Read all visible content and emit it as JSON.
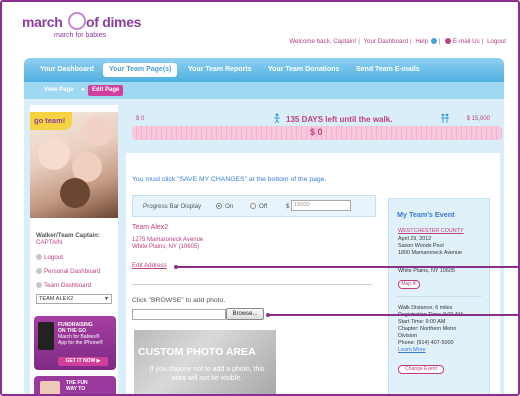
{
  "header": {
    "logo_word1": "march",
    "logo_word2": "of dimes",
    "logo_tagline": "march for babies",
    "links": [
      "Welcome back, Captain!",
      "Your Dashboard",
      "Help",
      "E-mail Us",
      "Logout"
    ]
  },
  "tabs": [
    {
      "label": "Your Dashboard"
    },
    {
      "label": "Your Team Page(s)"
    },
    {
      "label": "Your Team Reports"
    },
    {
      "label": "Your Team Donations"
    },
    {
      "label": "Send Team E-mails"
    }
  ],
  "subtabs": [
    {
      "label": "View Page"
    },
    {
      "label": "Edit Page"
    }
  ],
  "sidebar": {
    "photo_badge": "go team!",
    "walker_label": "Walker/Team Captain:",
    "walker_value": "CAPTAIN",
    "links": [
      "Logout",
      "Personal Dashboard",
      "Team Dashboard"
    ],
    "team_select": "TEAM ALEX2",
    "promo1_text": [
      "FUNDRAISING",
      "ON THE GO",
      "March for Babies®",
      "App for the iPhone®"
    ],
    "promo1_button": "GET IT NOW ▶",
    "promo2_text": [
      "THE FUN",
      "WAY TO"
    ]
  },
  "progress": {
    "start_amount": "$ 0",
    "goal_amount": "$ 15,000",
    "days_left": "135 DAYS left until the walk.",
    "current": "$ 0",
    "fraction": 0
  },
  "form": {
    "notice": "You must click \"SAVE MY CHANGES\" at the bottom of the page.",
    "progress_bar_label": "Progress Bar Display",
    "on_label": "On",
    "off_label": "Off",
    "dollar_sign": "$",
    "goal_value": "15000",
    "team_name": "Team Alex2",
    "address_line1": "1275 Mamaroneck Avenue",
    "address_line2": "White Plains, NY (10605)",
    "edit_address": "Edit Address",
    "browse_hint": "Click \"BROWSE\" to add photo.",
    "browse_label": "Browse...",
    "photo_area_title": "CUSTOM PHOTO AREA",
    "photo_area_sub": "If you choose not to add a photo, this area will not be visible."
  },
  "event": {
    "title": "My Team's Event",
    "county": "WESTCHESTER COUNTY",
    "lines": [
      "April 29, 2012",
      "Saxon Woods Pool",
      "1800 Mamaroneck Avenue"
    ],
    "city": "White Plains, NY 10605",
    "map_label": "Map It!",
    "details": [
      "Walk Distance: 6 miles",
      "Registration Time: 8:00 AM",
      "Start Time: 9:00 AM",
      "Chapter: Northern Metro",
      "Division",
      "Phone: (914) 407-5000"
    ],
    "learn_more": "Learn More",
    "change_event": "Change Event"
  },
  "colors": {
    "brand_purple": "#8a2f8f",
    "accent_pink": "#c04080",
    "tab_blue": "#4fb0e0",
    "link_blue": "#3a7bd5"
  }
}
